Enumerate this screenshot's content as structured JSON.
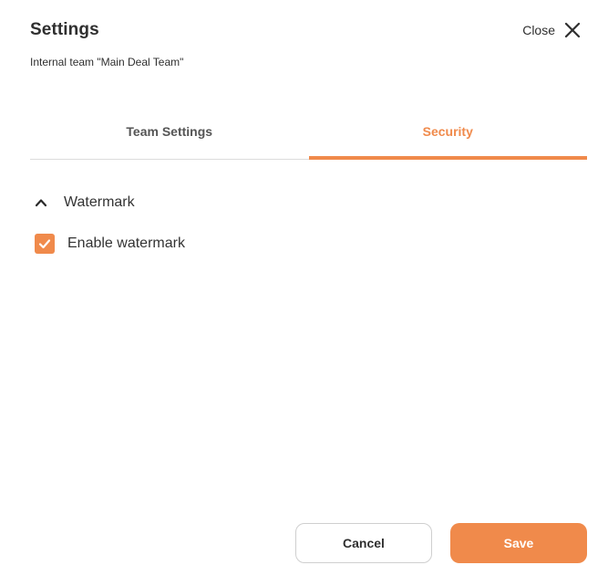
{
  "header": {
    "title": "Settings",
    "subtitle": "Internal team \"Main Deal Team\"",
    "close_label": "Close",
    "close_icon": "close-icon"
  },
  "tabs": [
    {
      "label": "Team Settings",
      "active": false
    },
    {
      "label": "Security",
      "active": true
    }
  ],
  "security": {
    "section": {
      "label": "Watermark",
      "expanded": true,
      "icon": "chevron-up-icon"
    },
    "enable_watermark": {
      "label": "Enable watermark",
      "checked": true
    }
  },
  "footer": {
    "cancel_label": "Cancel",
    "save_label": "Save"
  },
  "colors": {
    "accent": "#f08a4b",
    "text": "#2f2f2f",
    "divider": "#dcdcdc"
  }
}
